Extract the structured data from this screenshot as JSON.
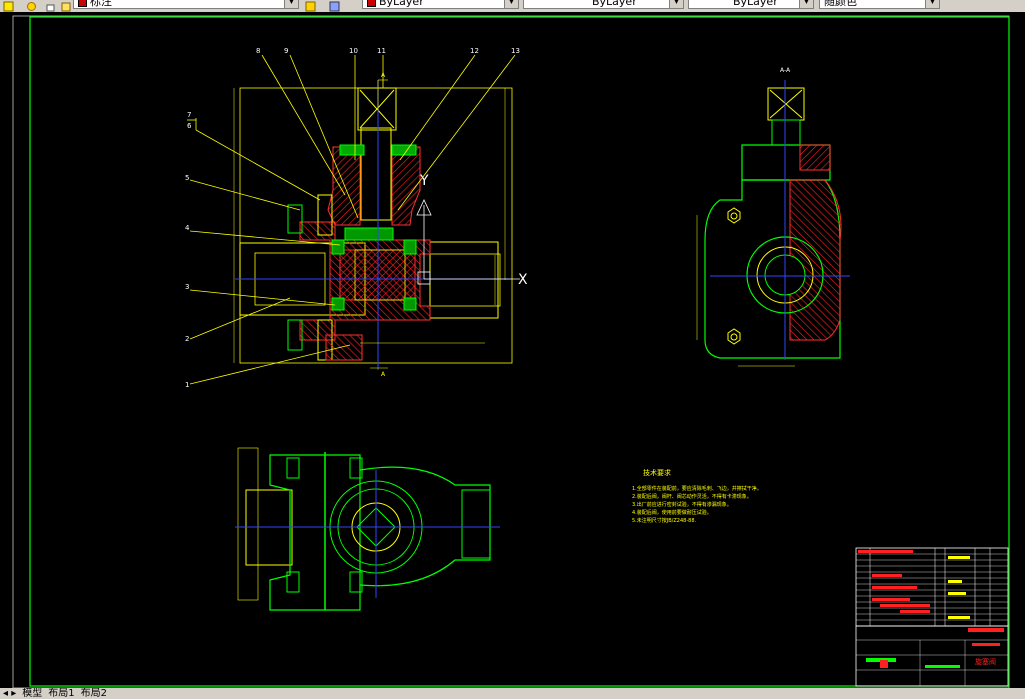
{
  "toolbar": {
    "text_style": "标注",
    "layer_color": "ByLayer",
    "linetype": "ByLayer",
    "lineweight": "ByLayer",
    "plot_style": "随颜色"
  },
  "drawing": {
    "balloons": [
      "1",
      "2",
      "3",
      "4",
      "5",
      "6",
      "7",
      "8",
      "9",
      "10",
      "11",
      "12",
      "13"
    ],
    "section_label": "A-A",
    "section_mark": "A",
    "axis_x": "X",
    "axis_y": "Y",
    "tech_title": "技术要求",
    "tech_notes": [
      "1.全部零件在装配前，要应清除毛刺、飞边，并擦拭干净。",
      "2.装配后阀，阀杆、阀芯动作灵活，不得有卡滞现象。",
      "3.出厂前应进行密封试验，不得有渗漏现象。",
      "4.装配后阀，使用前要做耐压试验。",
      "5.未注明尺寸按JB/Z248-88."
    ],
    "title_block_name": "旋塞阀"
  },
  "tabs": [
    "模型",
    "布局1",
    "布局2"
  ],
  "colors": {
    "background": "#000000",
    "yellow": "#ffff00",
    "green": "#00ff00",
    "red": "#ff0000",
    "blue": "#3333ff",
    "white": "#ffffff",
    "cyan": "#00ffff"
  }
}
